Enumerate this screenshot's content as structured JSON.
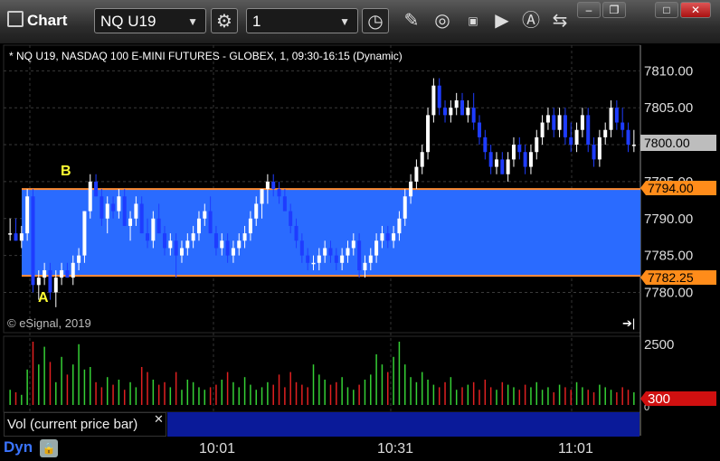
{
  "window": {
    "title": "Chart",
    "symbol": "NQ U19",
    "interval": "1",
    "min_label": "–",
    "restore_label": "❐",
    "maximize_label": "□",
    "close_label": "✕"
  },
  "chart": {
    "header": "* NQ U19, NASDAQ 100 E-MINI FUTURES - GLOBEX, 1, 09:30-16:15 (Dynamic)",
    "copyright": "© eSignal, 2019",
    "price_box_current": "7800.00",
    "price_box_upper": "7794.00",
    "price_box_lower": "7782.25",
    "label_a": "A",
    "label_b": "B",
    "colors": {
      "up": "#ffffff",
      "down": "#1e3cff",
      "range_fill": "#2a6bff",
      "range_line": "#ff8c33",
      "vol_up": "#35d035",
      "vol_down": "#e02020"
    }
  },
  "volume": {
    "label": "Vol (current price bar)",
    "axis_top": "2500",
    "axis_zero": "0",
    "current": "300"
  },
  "footer": {
    "dyn": "Dyn",
    "times": [
      "10:01",
      "10:31",
      "11:01"
    ]
  },
  "chart_data": {
    "type": "candlestick",
    "y_ticks": [
      7780,
      7785,
      7790,
      7795,
      7800,
      7805,
      7810
    ],
    "ylim": [
      7777,
      7812
    ],
    "range_upper": 7794.0,
    "range_lower": 7782.25,
    "current_price": 7800.0,
    "x_ticks": [
      "10:01",
      "10:31",
      "11:01"
    ],
    "candles": [
      [
        7788,
        7790,
        7787,
        7788
      ],
      [
        7788,
        7790,
        7787,
        7787
      ],
      [
        7787,
        7789,
        7786,
        7788
      ],
      [
        7788,
        7794,
        7787,
        7793
      ],
      [
        7793,
        7794,
        7780,
        7781
      ],
      [
        7781,
        7783,
        7779,
        7782
      ],
      [
        7782,
        7784,
        7781,
        7783
      ],
      [
        7783,
        7784,
        7779,
        7780
      ],
      [
        7780,
        7783,
        7778,
        7782
      ],
      [
        7782,
        7784,
        7781,
        7783
      ],
      [
        7783,
        7784,
        7782,
        7782
      ],
      [
        7782,
        7785,
        7781,
        7784
      ],
      [
        7784,
        7786,
        7783,
        7785
      ],
      [
        7785,
        7791,
        7784,
        7791
      ],
      [
        7791,
        7796,
        7790,
        7795
      ],
      [
        7795,
        7796,
        7793,
        7793
      ],
      [
        7793,
        7794,
        7789,
        7790
      ],
      [
        7790,
        7793,
        7788,
        7792
      ],
      [
        7792,
        7793,
        7790,
        7791
      ],
      [
        7791,
        7794,
        7790,
        7793
      ],
      [
        7793,
        7794,
        7789,
        7789
      ],
      [
        7789,
        7791,
        7787,
        7790
      ],
      [
        7790,
        7793,
        7789,
        7792
      ],
      [
        7792,
        7793,
        7788,
        7788
      ],
      [
        7788,
        7790,
        7786,
        7787
      ],
      [
        7787,
        7791,
        7786,
        7790
      ],
      [
        7790,
        7792,
        7788,
        7788
      ],
      [
        7788,
        7789,
        7785,
        7786
      ],
      [
        7786,
        7788,
        7785,
        7787
      ],
      [
        7787,
        7788,
        7782,
        7785
      ],
      [
        7785,
        7787,
        7784,
        7786
      ],
      [
        7786,
        7788,
        7785,
        7787
      ],
      [
        7787,
        7789,
        7786,
        7788
      ],
      [
        7788,
        7791,
        7787,
        7790
      ],
      [
        7790,
        7792,
        7789,
        7791
      ],
      [
        7791,
        7793,
        7788,
        7788
      ],
      [
        7788,
        7789,
        7785,
        7786
      ],
      [
        7786,
        7788,
        7785,
        7787
      ],
      [
        7787,
        7788,
        7784,
        7785
      ],
      [
        7785,
        7787,
        7784,
        7786
      ],
      [
        7786,
        7788,
        7785,
        7787
      ],
      [
        7787,
        7789,
        7786,
        7788
      ],
      [
        7788,
        7791,
        7787,
        7790
      ],
      [
        7790,
        7793,
        7789,
        7792
      ],
      [
        7792,
        7794,
        7790,
        7794
      ],
      [
        7794,
        7796,
        7792,
        7795
      ],
      [
        7795,
        7796,
        7793,
        7794
      ],
      [
        7794,
        7795,
        7792,
        7793
      ],
      [
        7793,
        7794,
        7791,
        7791
      ],
      [
        7791,
        7792,
        7788,
        7789
      ],
      [
        7789,
        7790,
        7786,
        7787
      ],
      [
        7787,
        7788,
        7784,
        7785
      ],
      [
        7785,
        7786,
        7783,
        7784
      ],
      [
        7784,
        7785,
        7783,
        7784
      ],
      [
        7784,
        7786,
        7783,
        7785
      ],
      [
        7785,
        7787,
        7784,
        7786
      ],
      [
        7786,
        7787,
        7784,
        7785
      ],
      [
        7785,
        7786,
        7783,
        7784
      ],
      [
        7784,
        7786,
        7783,
        7785
      ],
      [
        7785,
        7787,
        7784,
        7786
      ],
      [
        7786,
        7788,
        7785,
        7787
      ],
      [
        7787,
        7788,
        7782,
        7783
      ],
      [
        7783,
        7785,
        7782,
        7784
      ],
      [
        7784,
        7786,
        7783,
        7785
      ],
      [
        7785,
        7788,
        7784,
        7787
      ],
      [
        7787,
        7789,
        7786,
        7788
      ],
      [
        7788,
        7789,
        7786,
        7787
      ],
      [
        7787,
        7789,
        7786,
        7788
      ],
      [
        7788,
        7791,
        7787,
        7790
      ],
      [
        7790,
        7794,
        7789,
        7793
      ],
      [
        7793,
        7796,
        7792,
        7795
      ],
      [
        7795,
        7798,
        7794,
        7797
      ],
      [
        7797,
        7800,
        7796,
        7799
      ],
      [
        7799,
        7805,
        7798,
        7804
      ],
      [
        7804,
        7809,
        7803,
        7808
      ],
      [
        7808,
        7809,
        7804,
        7805
      ],
      [
        7805,
        7806,
        7803,
        7804
      ],
      [
        7804,
        7806,
        7803,
        7805
      ],
      [
        7805,
        7807,
        7804,
        7806
      ],
      [
        7806,
        7807,
        7804,
        7804
      ],
      [
        7804,
        7806,
        7803,
        7805
      ],
      [
        7805,
        7807,
        7802,
        7803
      ],
      [
        7803,
        7804,
        7800,
        7801
      ],
      [
        7801,
        7802,
        7798,
        7799
      ],
      [
        7799,
        7800,
        7796,
        7797
      ],
      [
        7797,
        7799,
        7796,
        7798
      ],
      [
        7798,
        7799,
        7796,
        7796
      ],
      [
        7796,
        7799,
        7795,
        7798
      ],
      [
        7798,
        7801,
        7797,
        7800
      ],
      [
        7800,
        7801,
        7798,
        7799
      ],
      [
        7799,
        7800,
        7796,
        7797
      ],
      [
        7797,
        7800,
        7796,
        7799
      ],
      [
        7799,
        7802,
        7798,
        7801
      ],
      [
        7801,
        7804,
        7800,
        7803
      ],
      [
        7803,
        7805,
        7802,
        7804
      ],
      [
        7804,
        7805,
        7801,
        7802
      ],
      [
        7802,
        7805,
        7801,
        7804
      ],
      [
        7804,
        7805,
        7800,
        7801
      ],
      [
        7801,
        7803,
        7799,
        7800
      ],
      [
        7800,
        7803,
        7799,
        7802
      ],
      [
        7802,
        7805,
        7801,
        7804
      ],
      [
        7804,
        7805,
        7799,
        7800
      ],
      [
        7800,
        7801,
        7797,
        7798
      ],
      [
        7798,
        7802,
        7797,
        7801
      ],
      [
        7801,
        7803,
        7800,
        7802
      ],
      [
        7802,
        7806,
        7801,
        7805
      ],
      [
        7805,
        7806,
        7802,
        7803
      ],
      [
        7803,
        7805,
        7801,
        7802
      ],
      [
        7802,
        7803,
        7799,
        7800
      ],
      [
        7800,
        7802,
        7799,
        7800
      ]
    ],
    "volume": [
      600,
      500,
      400,
      1400,
      2500,
      1600,
      2300,
      1700,
      900,
      1900,
      1200,
      1600,
      2400,
      1400,
      1500,
      900,
      700,
      1100,
      800,
      1000,
      600,
      900,
      700,
      1500,
      1300,
      1000,
      800,
      900,
      700,
      1300,
      600,
      1000,
      900,
      700,
      600,
      700,
      800,
      1000,
      1300,
      900,
      700,
      1100,
      800,
      600,
      700,
      900,
      800,
      1200,
      700,
      1300,
      900,
      800,
      700,
      1600,
      1200,
      1000,
      800,
      900,
      1100,
      700,
      600,
      800,
      1000,
      1200,
      2000,
      1600,
      1300,
      1900,
      2500,
      1600,
      1100,
      900,
      1300,
      1000,
      800,
      700,
      900,
      1100,
      600,
      700,
      800,
      900,
      600,
      1000,
      700,
      600,
      900,
      800,
      700,
      600,
      800,
      700,
      900,
      600,
      700,
      500,
      800,
      700,
      600,
      900,
      700,
      600,
      500,
      800,
      700,
      600,
      500,
      700,
      600,
      500
    ]
  }
}
